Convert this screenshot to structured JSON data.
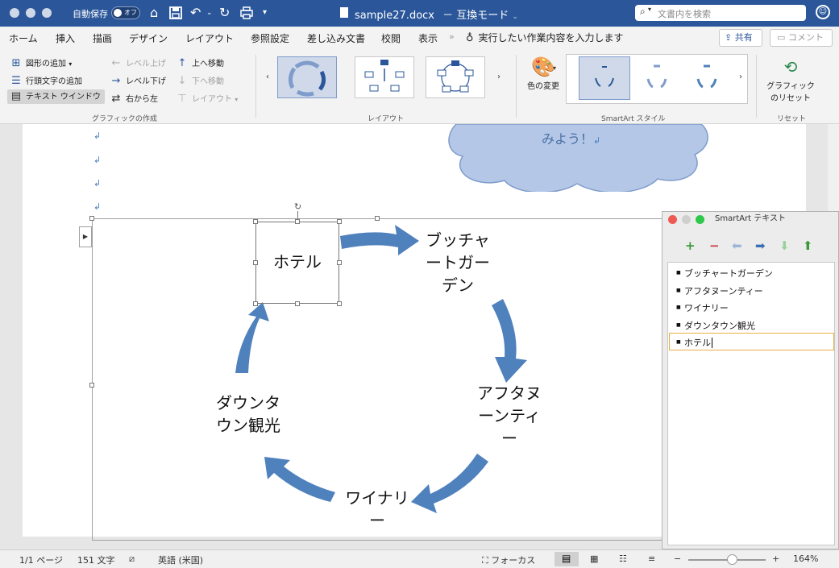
{
  "titlebar": {
    "autosave_label": "自動保存",
    "autosave_state": "オフ",
    "document_title": "sample27.docx",
    "mode": "－ 互換モード",
    "search_placeholder": "文書内を検索"
  },
  "tabs": [
    "ホーム",
    "挿入",
    "描画",
    "デザイン",
    "レイアウト",
    "参照設定",
    "差し込み文書",
    "校閲",
    "表示"
  ],
  "tell_me": "実行したい作業内容を入力します",
  "share_label": "共有",
  "comment_label": "コメント",
  "ribbon": {
    "create_graphic": {
      "group_label": "グラフィックの作成",
      "add_shape": "図形の追加",
      "add_bullet": "行頭文字の追加",
      "text_pane": "テキスト ウインドウ",
      "promote": "レベル上げ",
      "demote": "レベル下げ",
      "right_to_left": "右から左",
      "move_up": "上へ移動",
      "move_down": "下へ移動",
      "layout": "レイアウト"
    },
    "layouts": {
      "group_label": "レイアウト"
    },
    "styles": {
      "group_label": "SmartArt スタイル",
      "change_colors": "色の変更"
    },
    "reset": {
      "group_label": "リセット",
      "reset_graphic_line1": "グラフィック",
      "reset_graphic_line2": "のリセット"
    }
  },
  "document": {
    "cloud_text": "みよう！"
  },
  "smartart": {
    "nodes": {
      "hotel": "ホテル",
      "butchart_1": "ブッチャ",
      "butchart_2": "ートガー",
      "butchart_3": "デン",
      "afternoon_1": "アフタヌ",
      "afternoon_2": "ーンティ",
      "afternoon_3": "ー",
      "winery_1": "ワイナリ",
      "winery_2": "ー",
      "downtown_1": "ダウンタ",
      "downtown_2": "ウン観光"
    }
  },
  "text_pane": {
    "title": "SmartArt テキスト",
    "items": [
      "ブッチャートガーデン",
      "アフタヌーンティー",
      "ワイナリー",
      "ダウンタウン観光",
      "ホテル"
    ]
  },
  "statusbar": {
    "page": "1/1 ページ",
    "words": "151 文字",
    "language": "英語 (米国)",
    "focus": "フォーカス",
    "zoom": "164%"
  },
  "colors": {
    "titlebar": "#2b579a",
    "arrow": "#4f81bd",
    "cloud_fill": "#b4c7e7",
    "cloud_stroke": "#7f9ccb"
  }
}
